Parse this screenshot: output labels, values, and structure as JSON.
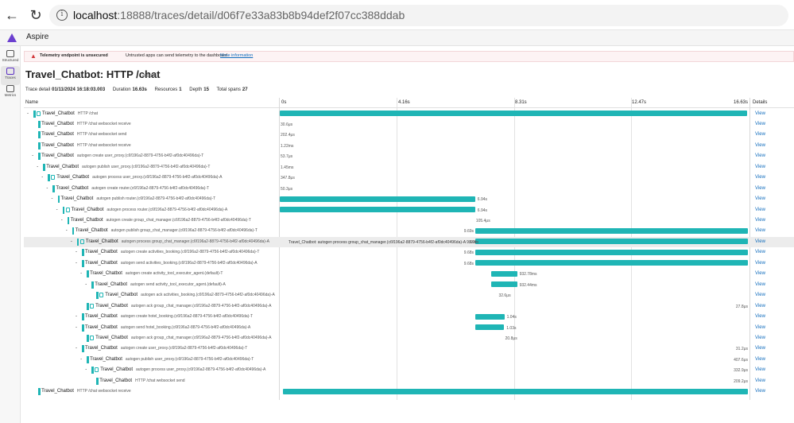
{
  "browser": {
    "back_glyph": "←",
    "reload_glyph": "↻",
    "info_glyph": "i",
    "url_host": "localhost",
    "url_rest": ":18888/traces/detail/d06f7e33a83b8b94def2f07cc388ddab"
  },
  "app": {
    "title": "Aspire"
  },
  "rail": [
    {
      "label": "Structured",
      "icon": "structured-logs-icon",
      "active": false
    },
    {
      "label": "Traces",
      "icon": "traces-icon",
      "active": true
    },
    {
      "label": "Metrics",
      "icon": "metrics-icon",
      "active": false
    }
  ],
  "banner": {
    "warn_glyph": "▲",
    "title": "Telemetry endpoint is unsecured",
    "message": "Untrusted apps can send telemetry to the dashboard.",
    "link": "More information"
  },
  "page": {
    "title": "Travel_Chatbot: HTTP /chat",
    "trace_id": "d06f7e3"
  },
  "summary": {
    "trace_detail_label": "Trace detail",
    "trace_detail_value": "01/11/2024 16:18:03.003",
    "duration_label": "Duration",
    "duration_value": "16.63s",
    "resources_label": "Resources",
    "resources_value": "1",
    "depth_label": "Depth",
    "depth_value": "15",
    "spans_label": "Total spans",
    "spans_value": "27"
  },
  "grid": {
    "name_header": "Name",
    "details_header": "Details",
    "ticks": [
      "0s",
      "4.16s",
      "8.31s",
      "12.47s",
      "16.63s"
    ],
    "total_seconds": 16.63,
    "view_label": "View",
    "collapse_glyph": "-"
  },
  "rows": [
    {
      "service": "Travel_Chatbot",
      "desc": "HTTP /chat",
      "depth": 0,
      "expander": true,
      "icon": true,
      "start": 0,
      "end": 16.6,
      "dur": ""
    },
    {
      "service": "Travel_Chatbot",
      "desc": "HTTP /chat websocket receive",
      "depth": 1,
      "expander": false,
      "icon": false,
      "start": 0,
      "end": 0,
      "dur": "30.6μs"
    },
    {
      "service": "Travel_Chatbot",
      "desc": "HTTP /chat websocket send",
      "depth": 1,
      "expander": false,
      "icon": false,
      "start": 0,
      "end": 0,
      "dur": "202.4μs"
    },
    {
      "service": "Travel_Chatbot",
      "desc": "HTTP /chat websocket receive",
      "depth": 1,
      "expander": false,
      "icon": false,
      "start": 0,
      "end": 0.03,
      "dur": "1.22ms"
    },
    {
      "service": "Travel_Chatbot",
      "desc": "autogen create user_proxy.(c6f196a2-8879-4756-b4f2-af0dc40496da)-T",
      "depth": 1,
      "expander": true,
      "icon": false,
      "start": 0,
      "end": 0,
      "dur": "53.7μs"
    },
    {
      "service": "Travel_Chatbot",
      "desc": "autogen publish user_proxy.(c6f196a2-8879-4756-b4f2-af0dc40496da)-T",
      "depth": 2,
      "expander": true,
      "icon": false,
      "start": 0,
      "end": 0.01,
      "dur": "1.45ms"
    },
    {
      "service": "Travel_Chatbot",
      "desc": "autogen process user_proxy.(c6f196a2-8879-4756-b4f2-af0dc40496da)-A",
      "depth": 3,
      "expander": true,
      "icon": true,
      "start": 0,
      "end": 0,
      "dur": "347.8μs"
    },
    {
      "service": "Travel_Chatbot",
      "desc": "autogen create router.(c6f196a2-8879-4756-b4f2-af0dc40496da)-T",
      "depth": 4,
      "expander": true,
      "icon": false,
      "start": 0,
      "end": 0,
      "dur": "50.3μs"
    },
    {
      "service": "Travel_Chatbot",
      "desc": "autogen publish router.(c6f196a2-8879-4756-b4f2-af0dc40496da)-T",
      "depth": 5,
      "expander": true,
      "icon": false,
      "start": 0,
      "end": 6.94,
      "dur": "6.94s"
    },
    {
      "service": "Travel_Chatbot",
      "desc": "autogen process router.(c6f196a2-8879-4756-b4f2-af0dc40496da)-A",
      "depth": 6,
      "expander": true,
      "icon": true,
      "start": 0,
      "end": 6.94,
      "dur": "6.94s"
    },
    {
      "service": "Travel_Chatbot",
      "desc": "autogen create group_chat_manager.(c6f196a2-8879-4756-b4f2-af0dc40496da)-T",
      "depth": 7,
      "expander": true,
      "icon": false,
      "start": 6.94,
      "end": 6.94,
      "dur": "105.4μs"
    },
    {
      "service": "Travel_Chatbot",
      "desc": "autogen publish group_chat_manager.(c6f196a2-8879-4756-b4f2-af0dc40496da)-T",
      "depth": 8,
      "expander": true,
      "icon": false,
      "start": 6.94,
      "end": 16.63,
      "dur": "9.69s"
    },
    {
      "service": "Travel_Chatbot",
      "desc": "autogen process group_chat_manager.(c6f196a2-8879-4756-b4f2-af0dc40496da)-A",
      "depth": 9,
      "expander": true,
      "icon": true,
      "start": 6.94,
      "end": 16.63,
      "dur": "9.69s",
      "selected": true,
      "sel_label": "Travel_Chatbot: autogen process group_chat_manager.(c6f196a2-8879-4756-b4f2-af0dc40496da)-A 9.69s"
    },
    {
      "service": "Travel_Chatbot",
      "desc": "autogen create activities_booking.(c6f196a2-8879-4756-b4f2-af0dc40496da)-T",
      "depth": 10,
      "expander": true,
      "icon": false,
      "start": 6.94,
      "end": 16.63,
      "dur": "9.68s"
    },
    {
      "service": "Travel_Chatbot",
      "desc": "autogen send activities_booking.(c6f196a2-8879-4756-b4f2-af0dc40496da)-A",
      "depth": 10,
      "expander": true,
      "icon": false,
      "start": 6.94,
      "end": 16.63,
      "dur": "9.68s"
    },
    {
      "service": "Travel_Chatbot",
      "desc": "autogen create activity_tool_executor_agent.(default)-T",
      "depth": 11,
      "expander": true,
      "icon": false,
      "start": 7.5,
      "end": 8.43,
      "dur": "932.78ms"
    },
    {
      "service": "Travel_Chatbot",
      "desc": "autogen send activity_tool_executor_agent.(default)-A",
      "depth": 12,
      "expander": true,
      "icon": false,
      "start": 7.5,
      "end": 8.43,
      "dur": "932.44ms"
    },
    {
      "service": "Travel_Chatbot",
      "desc": "autogen ack activities_booking.(c6f196a2-8879-4756-b4f2-af0dc40496da)-A",
      "depth": 13,
      "expander": false,
      "icon": true,
      "start": 7.75,
      "end": 7.75,
      "dur": "32.6μs"
    },
    {
      "service": "Travel_Chatbot",
      "desc": "autogen ack group_chat_manager.(c6f196a2-8879-4756-b4f2-af0dc40496da)-A",
      "depth": 11,
      "expander": false,
      "icon": true,
      "start": 16.2,
      "end": 16.2,
      "dur": "27.8μs"
    },
    {
      "service": "Travel_Chatbot",
      "desc": "autogen create hotel_booking.(c6f196a2-8879-4756-b4f2-af0dc40496da)-T",
      "depth": 10,
      "expander": true,
      "icon": false,
      "start": 6.94,
      "end": 7.98,
      "dur": "1.04s"
    },
    {
      "service": "Travel_Chatbot",
      "desc": "autogen send hotel_booking.(c6f196a2-8879-4756-b4f2-af0dc40496da)-A",
      "depth": 10,
      "expander": true,
      "icon": false,
      "start": 6.94,
      "end": 7.97,
      "dur": "1.03s"
    },
    {
      "service": "Travel_Chatbot",
      "desc": "autogen ack group_chat_manager.(c6f196a2-8879-4756-b4f2-af0dc40496da)-A",
      "depth": 11,
      "expander": false,
      "icon": true,
      "start": 7.98,
      "end": 7.98,
      "dur": "20.8μs"
    },
    {
      "service": "Travel_Chatbot",
      "desc": "autogen create user_proxy.(c6f196a2-8879-4756-b4f2-af0dc40496da)-T",
      "depth": 10,
      "expander": true,
      "icon": false,
      "start": 16.3,
      "end": 16.3,
      "dur": "31.2μs"
    },
    {
      "service": "Travel_Chatbot",
      "desc": "autogen publish user_proxy.(c6f196a2-8879-4756-b4f2-af0dc40496da)-T",
      "depth": 11,
      "expander": true,
      "icon": false,
      "start": 16.3,
      "end": 16.3,
      "dur": "407.6μs"
    },
    {
      "service": "Travel_Chatbot",
      "desc": "autogen process user_proxy.(c6f196a2-8879-4756-b4f2-af0dc40496da)-A",
      "depth": 12,
      "expander": true,
      "icon": true,
      "start": 16.3,
      "end": 16.3,
      "dur": "332.9μs"
    },
    {
      "service": "Travel_Chatbot",
      "desc": "HTTP /chat websocket send",
      "depth": 13,
      "expander": false,
      "icon": false,
      "start": 16.3,
      "end": 16.3,
      "dur": "209.2μs"
    },
    {
      "service": "Travel_Chatbot",
      "desc": "HTTP /chat websocket receive",
      "depth": 1,
      "expander": false,
      "icon": false,
      "start": 0.1,
      "end": 16.63,
      "dur": ""
    }
  ],
  "colors": {
    "accent": "#1fb5b5",
    "link": "#0f6cbd",
    "brand": "#6b3fcf"
  }
}
